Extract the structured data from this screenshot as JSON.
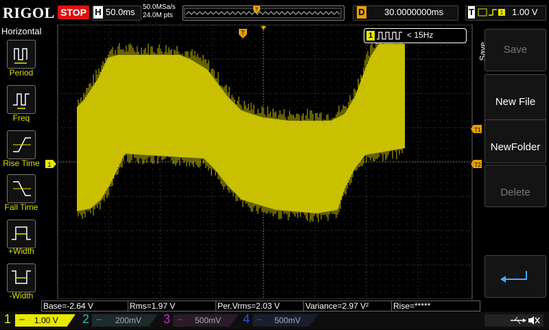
{
  "top": {
    "brand": "RIGOL",
    "run_state": "STOP",
    "timebase_letter": "H",
    "timebase": "50.0ms",
    "sample_rate": "50.0MSa/s",
    "memory_depth": "24.0M pts",
    "trigger_marker": "T",
    "delay_letter": "D",
    "delay": "30.0000000ms",
    "trigger_source_level": "1.00 V",
    "trigger_letter": "T"
  },
  "left_panel": {
    "title": "Horizontal",
    "items": [
      {
        "label": "Period"
      },
      {
        "label": "Freq"
      },
      {
        "label": "Rise Time"
      },
      {
        "label": "Fall Time"
      },
      {
        "label": "+Width"
      },
      {
        "label": "-Width"
      }
    ]
  },
  "grid": {
    "trigger_pos_marker": "T",
    "freq_box_channel": "1",
    "freq_box_text": "< 15Hz",
    "ch1_ground_marker": "1",
    "cursor_t1": "T1",
    "cursor_t2": "T2"
  },
  "right_menu": {
    "title": "Save",
    "buttons": [
      {
        "label": "Save",
        "enabled": false
      },
      {
        "label": "New File",
        "enabled": true
      },
      {
        "label": "NewFolder",
        "enabled": true
      },
      {
        "label": "Delete",
        "enabled": false
      }
    ]
  },
  "measurements": [
    {
      "text": "Base=-2.64 V"
    },
    {
      "text": "Rms=1.97 V"
    },
    {
      "text": "Per.Vrms=2.03 V"
    },
    {
      "text": "Variance=2.97 V²"
    },
    {
      "text": "Rise=*****"
    }
  ],
  "channels": [
    {
      "num": "1",
      "scale": "1.00 V",
      "color": "#e8e800",
      "active": true
    },
    {
      "num": "2",
      "scale": "200mV",
      "color": "#2fb8c8",
      "active": false
    },
    {
      "num": "3",
      "scale": "500mV",
      "color": "#c030c0",
      "active": false
    },
    {
      "num": "4",
      "scale": "500mV",
      "color": "#3050e0",
      "active": false
    }
  ],
  "colors": {
    "waveform": "#c8c000",
    "accent": "#e8a000",
    "stop": "#d11"
  }
}
